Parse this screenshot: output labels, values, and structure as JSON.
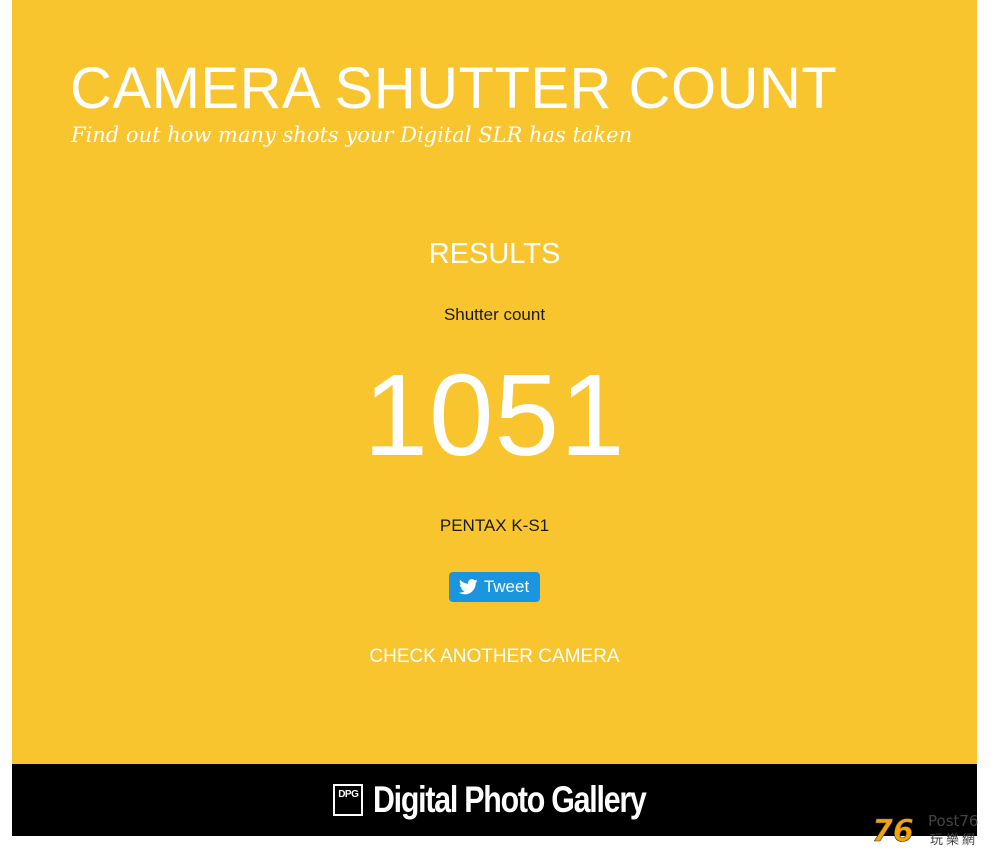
{
  "colors": {
    "panel_bg": "#F9C52E",
    "footer_bg": "#000000",
    "tweet_bg": "#1B95E0",
    "text_light": "#FFFFFF",
    "text_dark": "#1A1A1A"
  },
  "header": {
    "title": "CAMERA SHUTTER COUNT",
    "tagline": "Find out how many shots your Digital SLR has taken"
  },
  "results": {
    "heading": "RESULTS",
    "count_label": "Shutter count",
    "count_value": "1051",
    "camera_model": "PENTAX K-S1",
    "tweet_label": "Tweet",
    "tweet_icon": "twitter-bird-icon",
    "check_another_label": "CHECK ANOTHER CAMERA"
  },
  "footer": {
    "logo_mark": "DPG",
    "logo_text": "Digital Photo Gallery"
  },
  "watermark": {
    "brand": "Post76",
    "subtitle": "玩樂網"
  }
}
